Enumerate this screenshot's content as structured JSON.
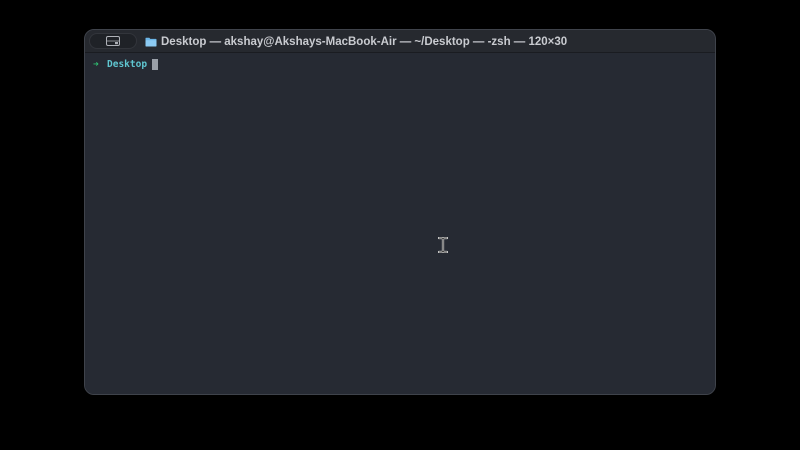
{
  "window": {
    "title": "Desktop — akshay@Akshays-MacBook-Air — ~/Desktop — -zsh — 120×30",
    "title_icon": "folder-icon",
    "sidebar_toggle_icon": "sidebar-icon"
  },
  "terminal": {
    "prompt_symbol": "➜",
    "current_directory": "Desktop",
    "input_text": ""
  },
  "colors": {
    "background": "#000000",
    "terminal_bg": "#262a33",
    "prompt_arrow": "#2fbf71",
    "prompt_dir": "#5fc6d1",
    "title_text": "#c9cbd0",
    "folder_icon": "#6cb6e8"
  },
  "mouse": {
    "cursor_icon": "ibeam-cursor-icon"
  }
}
